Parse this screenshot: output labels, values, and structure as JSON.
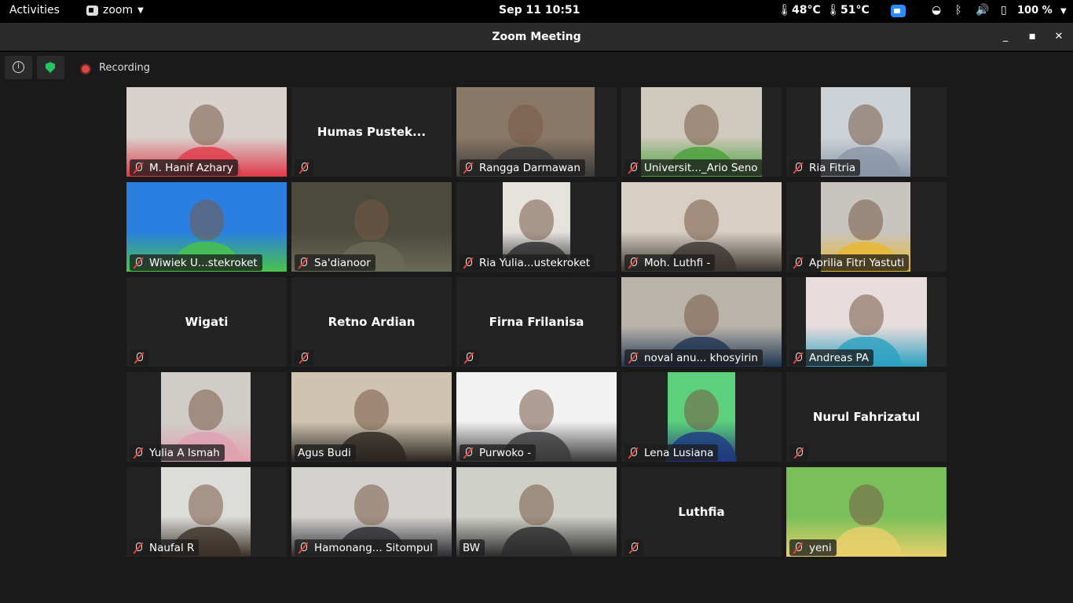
{
  "topbar": {
    "activities": "Activities",
    "app_name": "zoom",
    "clock": "Sep 11  10:51",
    "temp_cpu": "48°C",
    "temp_gpu": "51°C",
    "battery": "100 %"
  },
  "window": {
    "title": "Zoom Meeting"
  },
  "toolbar": {
    "recording_label": "Recording"
  },
  "participants": [
    {
      "name": "M. Hanif Azhary",
      "video": true,
      "bg": "#d9d2cc",
      "accent": "#e03a4a"
    },
    {
      "name": "Humas Pustek...",
      "video": false
    },
    {
      "name": "Rangga Darmawan",
      "video": true,
      "bg": "#8a7866",
      "accent": "#3a3a3a"
    },
    {
      "name": "Universit..._Ario Seno",
      "video": true,
      "bg": "#cfc9bd",
      "accent": "#4aa03a"
    },
    {
      "name": "Ria Fitria",
      "video": true,
      "bg": "#cdd2d6",
      "accent": "#8a96a8"
    },
    {
      "name": "Wiwiek U...stekroket",
      "video": true,
      "bg": "#2a7fe0",
      "accent": "#4ac24a"
    },
    {
      "name": "Sa'dianoor",
      "video": true,
      "bg": "#4b4a3c",
      "accent": "#6b6a56"
    },
    {
      "name": "Ria Yulia...ustekroket",
      "video": true,
      "bg": "#e6e3df",
      "accent": "#2a2a2a"
    },
    {
      "name": "Moh. Luthfi -",
      "video": true,
      "bg": "#d8cfc4",
      "accent": "#3a3530"
    },
    {
      "name": "Aprilia Fitri Yastuti",
      "video": true,
      "bg": "#c8c4c0",
      "accent": "#e8b830"
    },
    {
      "name": "Wigati",
      "video": false
    },
    {
      "name": "Retno Ardian",
      "video": false
    },
    {
      "name": "Firna Frilanisa",
      "video": false
    },
    {
      "name": "noval anu... khosyirin",
      "video": true,
      "bg": "#b9b3aa",
      "accent": "#1e3552"
    },
    {
      "name": "Andreas PA",
      "video": true,
      "bg": "#e8dcdc",
      "accent": "#2aa0c0"
    },
    {
      "name": "Yulia A Ismah",
      "video": true,
      "bg": "#d0cdc8",
      "accent": "#e0a0b0"
    },
    {
      "name": "Agus Budi",
      "video": true,
      "bg": "#cfc4b0",
      "accent": "#2a2520"
    },
    {
      "name": "Purwoko -",
      "video": true,
      "bg": "#f2f2f2",
      "accent": "#3a3a3a"
    },
    {
      "name": "Lena Lusiana",
      "video": true,
      "bg": "#5cd07a",
      "accent": "#1e3a80"
    },
    {
      "name": "Nurul Fahrizatul",
      "video": false
    },
    {
      "name": "Naufal R",
      "video": true,
      "bg": "#dcdcd8",
      "accent": "#3a3028"
    },
    {
      "name": "Hamonang... Sitompul",
      "video": true,
      "bg": "#d4d2cf",
      "accent": "#2a2a30"
    },
    {
      "name": "BW",
      "video": true,
      "bg": "#cfd0c8",
      "accent": "#2a2a2a"
    },
    {
      "name": "Luthfia",
      "video": false
    },
    {
      "name": "yeni",
      "video": true,
      "bg": "#7ac05a",
      "accent": "#e8d06a"
    }
  ]
}
